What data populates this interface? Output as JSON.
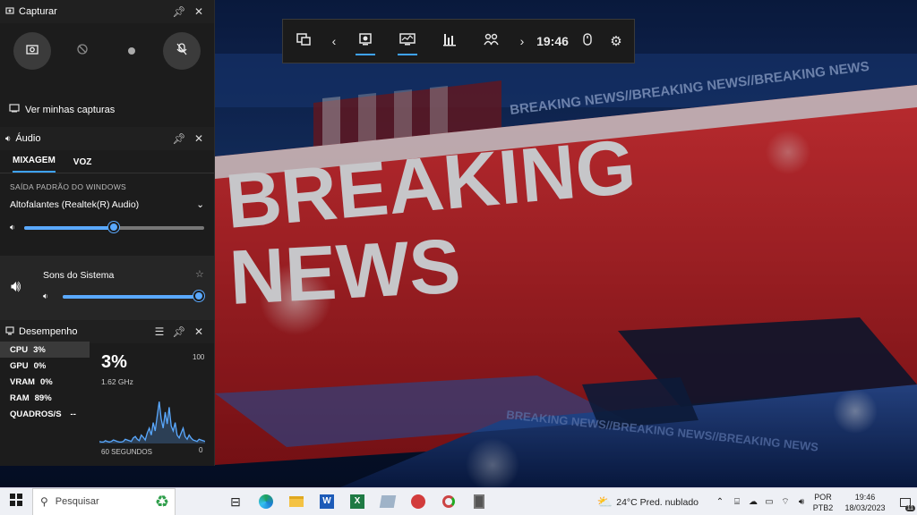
{
  "background": {
    "headline_line1": "BREAKING",
    "headline_line2": "NEWS",
    "ticker_text": "BREAKING NEWS//BREAKING NEWS//BREAKING NEWS"
  },
  "gamebar": {
    "time": "19:46",
    "widgets": [
      "widget-menu-icon",
      "capture-icon",
      "performance-icon",
      "resources-icon",
      "social-icon"
    ]
  },
  "capture_panel": {
    "title": "Capturar",
    "view_captures": "Ver minhas capturas"
  },
  "audio_panel": {
    "title": "Áudio",
    "tabs": [
      "MIXAGEM",
      "VOZ"
    ],
    "default_output_label": "SAÍDA PADRÃO DO WINDOWS",
    "device": "Altofalantes (Realtek(R) Audio)",
    "device_volume": 0.5,
    "system_sounds_label": "Sons do Sistema",
    "system_volume": 1.0
  },
  "performance_panel": {
    "title": "Desempenho",
    "metrics": [
      {
        "label": "CPU",
        "value": "3%"
      },
      {
        "label": "GPU",
        "value": "0%"
      },
      {
        "label": "VRAM",
        "value": "0%"
      },
      {
        "label": "RAM",
        "value": "89%"
      },
      {
        "label": "QUADROS/S",
        "value": "--"
      }
    ],
    "big_value": "3%",
    "frequency": "1.62 GHz",
    "max_label": "100",
    "min_label": "0",
    "window_label": "60 SEGUNDOS",
    "cpu_history": [
      3,
      2,
      2,
      4,
      3,
      2,
      3,
      5,
      4,
      3,
      2,
      2,
      3,
      6,
      5,
      4,
      3,
      8,
      10,
      6,
      4,
      12,
      9,
      5,
      15,
      22,
      12,
      30,
      18,
      40,
      60,
      35,
      22,
      45,
      28,
      52,
      25,
      18,
      30,
      12,
      8,
      15,
      22,
      10,
      6,
      12,
      8,
      5,
      4,
      3,
      6,
      5,
      4,
      3
    ]
  },
  "taskbar": {
    "search_placeholder": "Pesquisar",
    "weather": "24°C  Pred. nublado",
    "lang1": "POR",
    "lang2": "PTB2",
    "time": "19:46",
    "date": "18/03/2023",
    "notif_count": "11"
  },
  "colors": {
    "accent": "#3ea3ff",
    "panel_bg": "#1c1c1c",
    "graph_line": "#5aa9ff",
    "news_red": "#c4242a"
  }
}
